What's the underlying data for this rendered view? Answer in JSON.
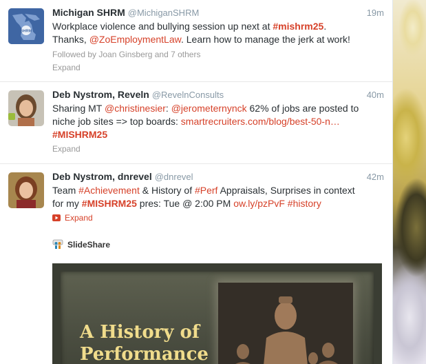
{
  "colors": {
    "accent": "#d64129",
    "text": "#292f33",
    "muted": "#8899a6"
  },
  "tweets": [
    {
      "name": "Michigan SHRM",
      "handle": "@MichiganSHRM",
      "time": "19m",
      "avatar_text": "SHRM",
      "text_parts": {
        "a": "Workplace violence and bullying session  up next at ",
        "b": "#mishrm25",
        "c": ".",
        "d": "Thanks, ",
        "e": "@ZoEmploymentLaw",
        "f": ". Learn how to manage the jerk at work!"
      },
      "followed_by": "Followed by Joan Ginsberg and 7 others",
      "expand": "Expand"
    },
    {
      "name": "Deb Nystrom, Reveln",
      "handle": "@RevelnConsults",
      "time": "40m",
      "text_parts": {
        "a": "Sharing MT ",
        "b": "@christinesier",
        "c": ": ",
        "d": "@jerometernynck",
        "e": " 62% of jobs are posted to",
        "f": "niche job sites => top boards: ",
        "g": "smartrecruiters.com/blog/best-50-n…",
        "h": "#MISHRM25"
      },
      "expand": "Expand"
    },
    {
      "name": "Deb Nystrom, dnrevel",
      "handle": "@dnrevel",
      "time": "42m",
      "text_parts": {
        "a": "Team ",
        "b": "#Achievement",
        "c": " & History of ",
        "d": "#Perf",
        "e": " Appraisals, Surprises in context",
        "f": "for my ",
        "g": "#MISHRM25",
        "h": " pres: Tue @ 2:00 PM  ",
        "i": "ow.ly/pzPvF",
        "j": " ",
        "k": "#history"
      },
      "expand": "Expand",
      "media_source": "SlideShare",
      "slide_title_1": "A History of",
      "slide_title_2": "Performance"
    }
  ]
}
